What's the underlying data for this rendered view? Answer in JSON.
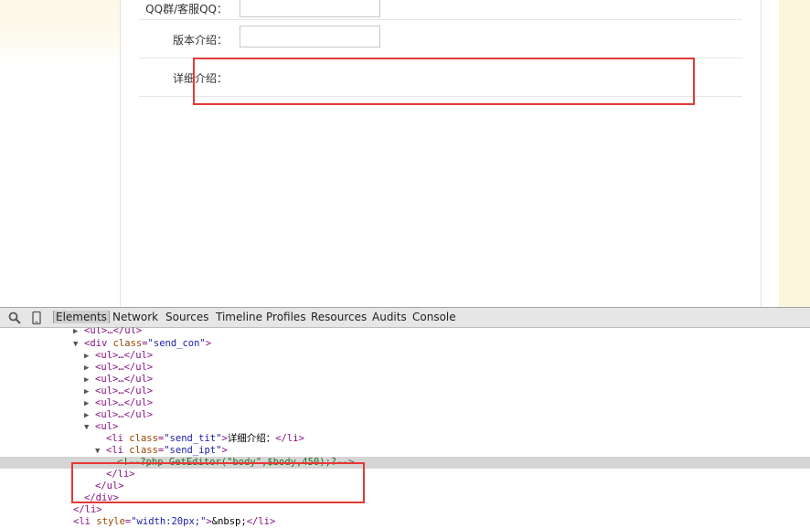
{
  "form": {
    "rows": [
      {
        "label": "QQ群/客服QQ："
      },
      {
        "label": "版本介绍："
      },
      {
        "label": "详细介绍："
      }
    ]
  },
  "devtools": {
    "tabs": [
      "Elements",
      "Network",
      "Sources",
      "Timeline",
      "Profiles",
      "Resources",
      "Audits",
      "Console"
    ],
    "active_tab": "Elements",
    "lines": {
      "l0_tag": "<ul>…</ul>",
      "l1_open": "<div ",
      "l1_attr": "class",
      "l1_val": "\"send_con\"",
      "l1_close": ">",
      "collapsed_ul": "<ul>…</ul>",
      "l8_tag": "<ul>",
      "l9_open": "<li ",
      "l9_attr": "class",
      "l9_val": "\"send_tit\"",
      "l9_close": ">",
      "l9_text": "详细介绍：",
      "l9_end": "</li>",
      "l10_open": "<li ",
      "l10_attr": "class",
      "l10_val": "\"send_ipt\"",
      "l10_close": ">",
      "l11_comment": "<!--?php GetEditor(\"body\",$body,450);?-->",
      "l12_tag": "</li>",
      "l13_tag": "</ul>",
      "l14_tag": "</div>",
      "l15_tag": "</li>",
      "l16_open": "<li ",
      "l16_attr": "style",
      "l16_val": "\"width:20px;\"",
      "l16_close": ">",
      "l16_text": "&nbsp;",
      "l16_end": "</li>"
    }
  },
  "colors": {
    "highlight": "#e53935",
    "tag": "#881280",
    "attr_name": "#994500",
    "attr_value": "#1a1aa6",
    "comment": "#236e25"
  }
}
